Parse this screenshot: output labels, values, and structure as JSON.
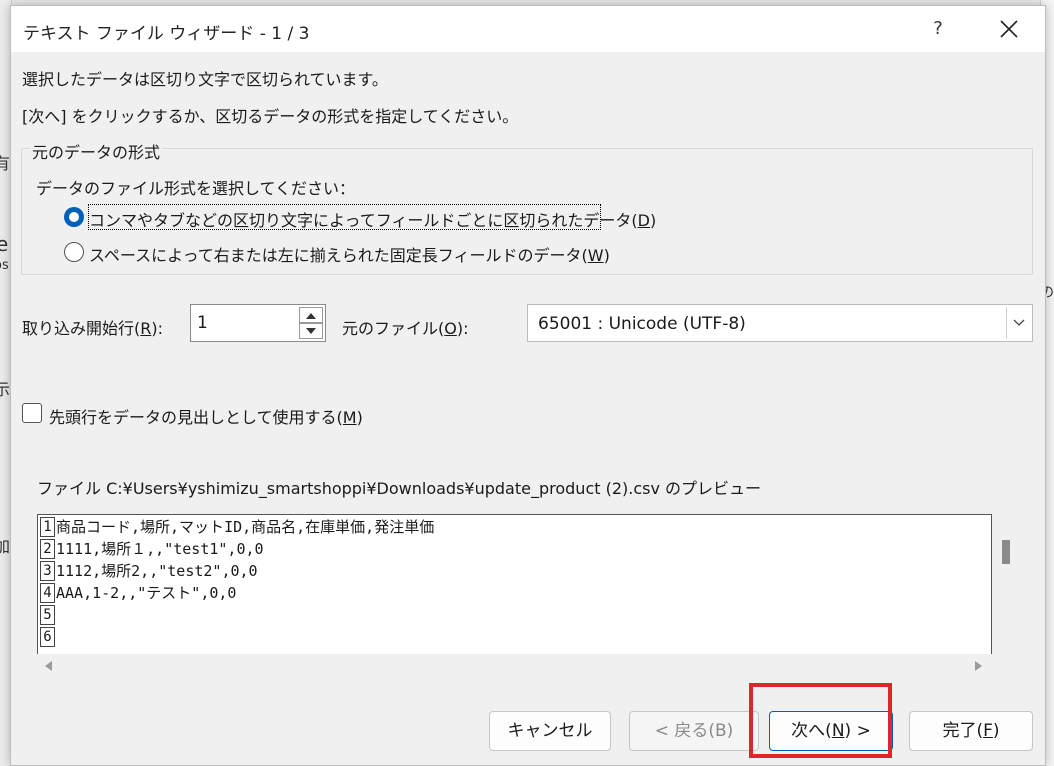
{
  "background": {
    "frag_a": "e",
    "frag_b": "os",
    "frag_c": "有",
    "frag_d": "示",
    "frag_e": "加",
    "frag_f": "の"
  },
  "dialog": {
    "title": "テキスト ファイル ウィザード - 1 / 3",
    "help": "?",
    "intro_line1": "選択したデータは区切り文字で区切られています。",
    "intro_line2": "[次へ] をクリックするか、区切るデータの形式を指定してください。"
  },
  "format_group": {
    "legend": "元のデータの形式",
    "prompt": "データのファイル形式を選択してください：",
    "options": [
      {
        "label_pre": "コンマやタブなどの区切り文字によってフィールドごとに区切られたデータ(",
        "key": "D",
        "label_post": ")",
        "selected": true
      },
      {
        "label_pre": "スペースによって右または左に揃えられた固定長フィールドのデータ(",
        "key": "W",
        "label_post": ")",
        "selected": false
      }
    ]
  },
  "start_row": {
    "label_pre": "取り込み開始行(",
    "key": "R",
    "label_post": "):",
    "value": "1"
  },
  "origin": {
    "label_pre": "元のファイル(",
    "key": "O",
    "label_post": "):",
    "value": "65001 : Unicode (UTF-8)"
  },
  "header_checkbox": {
    "label_pre": "先頭行をデータの見出しとして使用する(",
    "key": "M",
    "label_post": ")",
    "checked": false
  },
  "preview": {
    "caption": "ファイル C:¥Users¥yshimizu_smartshoppi¥Downloads¥update_product (2).csv のプレビュー",
    "rows": [
      {
        "num": "1",
        "text": "商品コード,場所,マットID,商品名,在庫単価,発注単価"
      },
      {
        "num": "2",
        "text": "1111,場所１,,\"test1\",0,0"
      },
      {
        "num": "3",
        "text": "1112,場所2,,\"test2\",0,0"
      },
      {
        "num": "4",
        "text": "AAA,1-2,,\"テスト\",0,0"
      },
      {
        "num": "5",
        "text": ""
      },
      {
        "num": "6",
        "text": ""
      }
    ]
  },
  "buttons": {
    "cancel": "キャンセル",
    "back_pre": "< 戻る(B)",
    "next_pre": "次へ(",
    "next_key": "N",
    "next_post": ") >",
    "finish_pre": "完了(",
    "finish_key": "F",
    "finish_post": ")"
  },
  "colors": {
    "accent": "#005fb8",
    "highlight": "#e2242b"
  }
}
